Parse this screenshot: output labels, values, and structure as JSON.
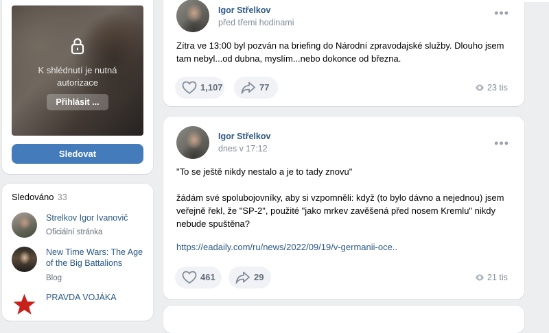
{
  "profile": {
    "locked_text": "K shlédnutí je nutná autorizace",
    "login_label": "Přihlásit ...",
    "follow_label": "Sledovat"
  },
  "following": {
    "title": "Sledováno",
    "count": "33",
    "items": [
      {
        "name": "Strelkov Igor Ivanovič",
        "subtitle": "Oficiální stránka"
      },
      {
        "name": "New Time Wars: The Age of the Big Battalions",
        "subtitle": "Blog"
      },
      {
        "name": "PRAVDA VOJÁKA",
        "subtitle": ""
      }
    ]
  },
  "posts": [
    {
      "author": "Igor Střelkov",
      "time": "před třemi hodinami",
      "text": "Zítra ve 13:00 byl pozván na briefing do Národní zpravodajské služby. Dlouho jsem tam nebyl...od dubna, myslím...nebo dokonce od března.",
      "likes": "1,107",
      "shares": "77",
      "views": "23 tis"
    },
    {
      "author": "Igor Střelkov",
      "time": "dnes v 17:12",
      "text": "\"To se ještě nikdy nestalo a je to tady znovu\"\n\nžádám své spolubojovníky, aby si vzpomněli: když (to bylo dávno a nejednou) jsem veřejně řekl, že \"SP-2\", použité \"jako mrkev zavěšená před nosem Kremlu\" nikdy nebude spuštěna?",
      "link": "https://eadaily.com/ru/news/2022/09/19/v-germanii-oce..",
      "likes": "461",
      "shares": "29",
      "views": "21 tis"
    }
  ],
  "colors": {
    "accent": "#447bba",
    "link": "#2a5885",
    "muted": "#818c99",
    "background": "#edeef0"
  }
}
